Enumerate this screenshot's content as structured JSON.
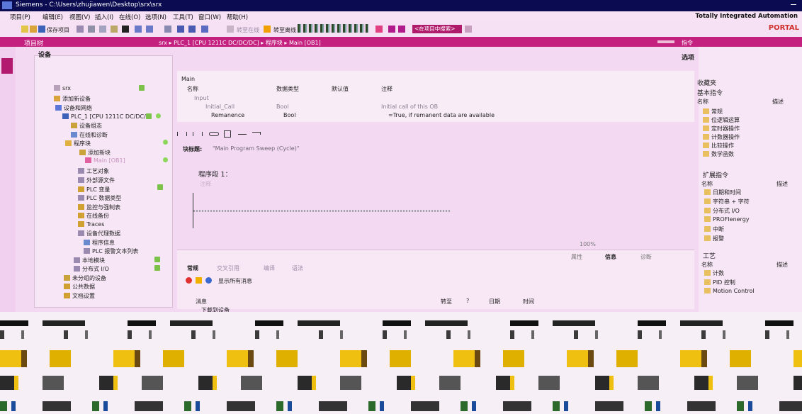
{
  "app": {
    "title": "Siemens - C:\\Users\\zhujiawen\\Desktop\\srx\\srx",
    "brand": "Totally Integrated Automation",
    "brand_sub": "PORTAL"
  },
  "menu": [
    "项目(P)",
    "编辑(E)",
    "视图(V)",
    "插入(I)",
    "在线(O)",
    "选项(N)",
    "工具(T)",
    "窗口(W)",
    "帮助(H)"
  ],
  "toolbar": {
    "save_label": "保存项目",
    "go_online": "转至在线",
    "go_offline": "转至离线",
    "search_placeholder": "<在项目中搜索>"
  },
  "project_tree": {
    "header": "项目树",
    "tab": "设备",
    "items": [
      {
        "label": "srx"
      },
      {
        "label": "添加新设备"
      },
      {
        "label": "设备和网络"
      },
      {
        "label": "PLC_1 [CPU 1211C DC/DC/..."
      },
      {
        "label": "设备组态"
      },
      {
        "label": "在线和诊断"
      },
      {
        "label": "程序块"
      },
      {
        "label": "添加新块"
      },
      {
        "label": "Main [OB1]"
      },
      {
        "label": "工艺对象"
      },
      {
        "label": "外部源文件"
      },
      {
        "label": "PLC 变量"
      },
      {
        "label": "PLC 数据类型"
      },
      {
        "label": "监控与强制表"
      },
      {
        "label": "在线备份"
      },
      {
        "label": "Traces"
      },
      {
        "label": "设备代理数据"
      },
      {
        "label": "程序信息"
      },
      {
        "label": "PLC 报警文本列表"
      },
      {
        "label": "本地模块"
      },
      {
        "label": "分布式 I/O"
      },
      {
        "label": "未分组的设备"
      },
      {
        "label": "公共数据"
      },
      {
        "label": "文档设置"
      }
    ]
  },
  "editor": {
    "breadcrumb": "srx ▸ PLC_1 [CPU 1211C DC/DC/DC] ▸ 程序块 ▸ Main [OB1]",
    "block_name": "Main",
    "columns": [
      "名称",
      "数据类型",
      "默认值",
      "注释"
    ],
    "section": "Input",
    "rows": [
      {
        "name": "Initial_Call",
        "type": "Bool",
        "default": "",
        "comment": "Initial call of this OB"
      },
      {
        "name": "Remanence",
        "type": "Bool",
        "default": "",
        "comment": "=True, if remanent data are available"
      }
    ],
    "block_title_label": "块标题:",
    "block_title": "\"Main Program Sweep (Cycle)\"",
    "network_title": "程序段 1：",
    "network_comment": "注释",
    "zoom": "100%"
  },
  "inspector": {
    "tabs": [
      "常规",
      "交叉引用",
      "编译",
      "语法"
    ],
    "right_tabs": [
      "属性",
      "信息",
      "诊断"
    ],
    "filter": "显示所有消息",
    "columns": [
      "消息",
      "转至",
      "?",
      "日期",
      "时间"
    ],
    "first_msg": "下载到设备"
  },
  "task_panel": {
    "header": "指令",
    "options": "选项",
    "favorites": "收藏夹",
    "basic": "基本指令",
    "col_name": "名称",
    "col_desc": "描述",
    "basic_items": [
      "常规",
      "位逻辑运算",
      "定时器操作",
      "计数器操作",
      "比较操作",
      "数学函数"
    ],
    "extended": "扩展指令",
    "extended_items": [
      "日期和时间",
      "字符串 + 字符",
      "分布式 I/O",
      "PROFIenergy",
      "中断",
      "报警"
    ],
    "tech": "工艺",
    "tech_items": [
      "计数",
      "PID 控制",
      "Motion Control"
    ]
  },
  "colors": {
    "accent": "#c42080",
    "title_bg": "#0b0b52",
    "panel_bg": "#f3d9f2"
  }
}
